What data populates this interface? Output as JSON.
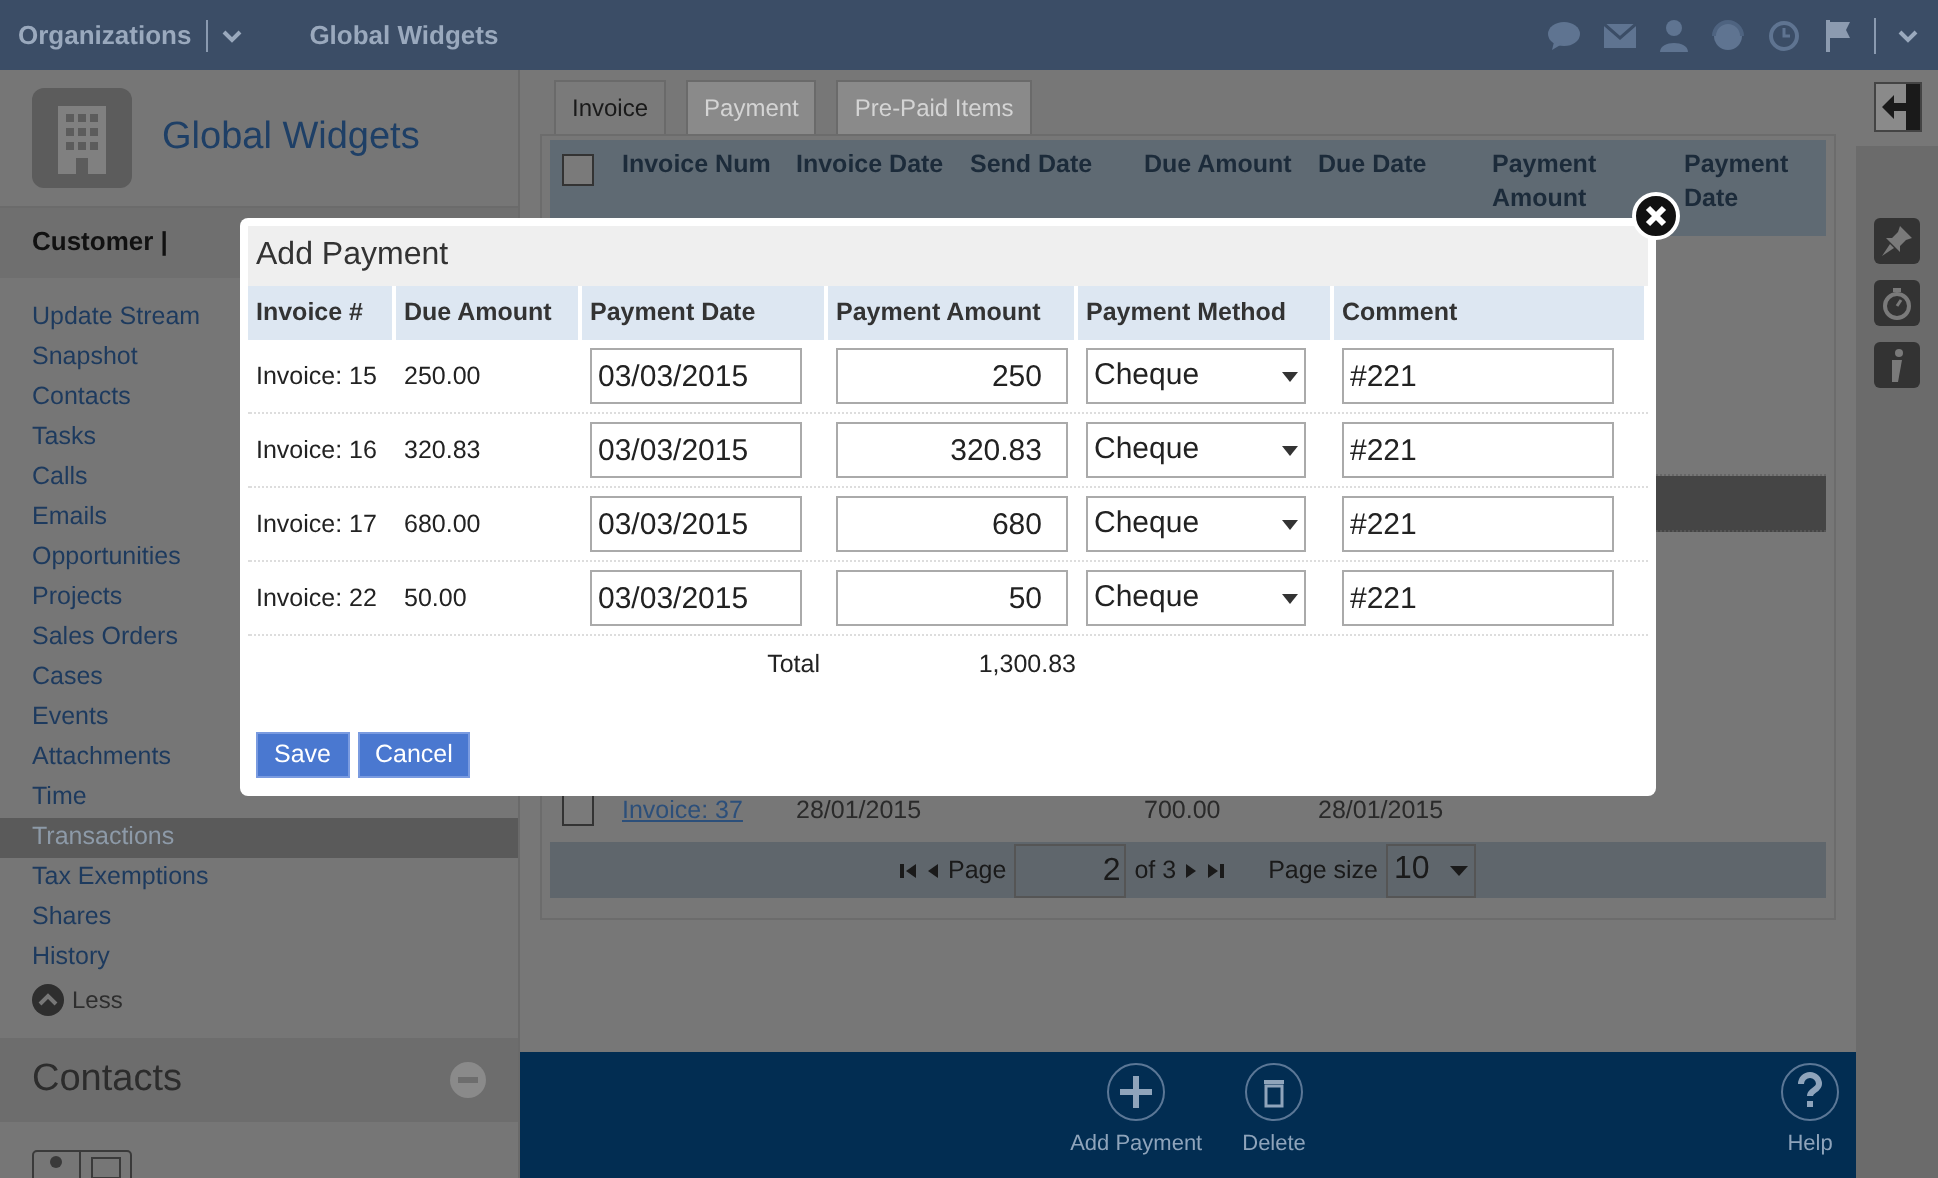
{
  "topbar": {
    "module": "Organizations",
    "record": "Global Widgets"
  },
  "sidebar": {
    "title": "Global Widgets",
    "type": "Customer |",
    "items": [
      {
        "label": "Update Stream",
        "selected": false
      },
      {
        "label": "Snapshot",
        "selected": false
      },
      {
        "label": "Contacts",
        "selected": false
      },
      {
        "label": "Tasks",
        "selected": false
      },
      {
        "label": "Calls",
        "selected": false
      },
      {
        "label": "Emails",
        "selected": false
      },
      {
        "label": "Opportunities",
        "selected": false
      },
      {
        "label": "Projects",
        "selected": false
      },
      {
        "label": "Sales Orders",
        "selected": false
      },
      {
        "label": "Cases",
        "selected": false
      },
      {
        "label": "Events",
        "selected": false
      },
      {
        "label": "Attachments",
        "selected": false
      },
      {
        "label": "Time",
        "selected": false
      },
      {
        "label": "Transactions",
        "selected": true
      },
      {
        "label": "Tax Exemptions",
        "selected": false
      },
      {
        "label": "Shares",
        "selected": false
      },
      {
        "label": "History",
        "selected": false
      }
    ],
    "toggle": "Less",
    "section": "Contacts"
  },
  "tabs": [
    {
      "label": "Invoice",
      "selected": true
    },
    {
      "label": "Payment",
      "selected": false
    },
    {
      "label": "Pre-Paid Items",
      "selected": false
    }
  ],
  "grid": {
    "columns": [
      "Invoice Num",
      "Invoice Date",
      "Send Date",
      "Due Amount",
      "Due Date",
      "Payment Amount",
      "Payment Date"
    ],
    "select_all": {
      "checked": false
    },
    "rows": [
      {
        "checked": false,
        "cells": [
          "Invoice: 37",
          "28/01/2015",
          "",
          "700.00",
          "28/01/2015",
          "",
          ""
        ]
      }
    ],
    "pager": {
      "label": "Page",
      "page": "2",
      "of": "of 3",
      "size_label": "Page size",
      "size": "10"
    }
  },
  "toolbar": [
    {
      "label": "Add Payment",
      "kind": "add"
    },
    {
      "label": "Delete",
      "kind": "delete"
    },
    {
      "label": "Help",
      "kind": "help"
    }
  ],
  "dialog": {
    "title": "Add Payment",
    "columns": [
      "Invoice #",
      "Due Amount",
      "Payment Date",
      "Payment Amount",
      "Payment Method",
      "Comment"
    ],
    "rows": [
      {
        "invoice": "Invoice: 15",
        "due": "250.00",
        "date": "03/03/2015",
        "amount": "250",
        "method": "Cheque",
        "comment": "#221"
      },
      {
        "invoice": "Invoice: 16",
        "due": "320.83",
        "date": "03/03/2015",
        "amount": "320.83",
        "method": "Cheque",
        "comment": "#221"
      },
      {
        "invoice": "Invoice: 17",
        "due": "680.00",
        "date": "03/03/2015",
        "amount": "680",
        "method": "Cheque",
        "comment": "#221"
      },
      {
        "invoice": "Invoice: 22",
        "due": "50.00",
        "date": "03/03/2015",
        "amount": "50",
        "method": "Cheque",
        "comment": "#221"
      }
    ],
    "total_label": "Total",
    "total": "1,300.83",
    "buttons": [
      "Save",
      "Cancel"
    ]
  }
}
